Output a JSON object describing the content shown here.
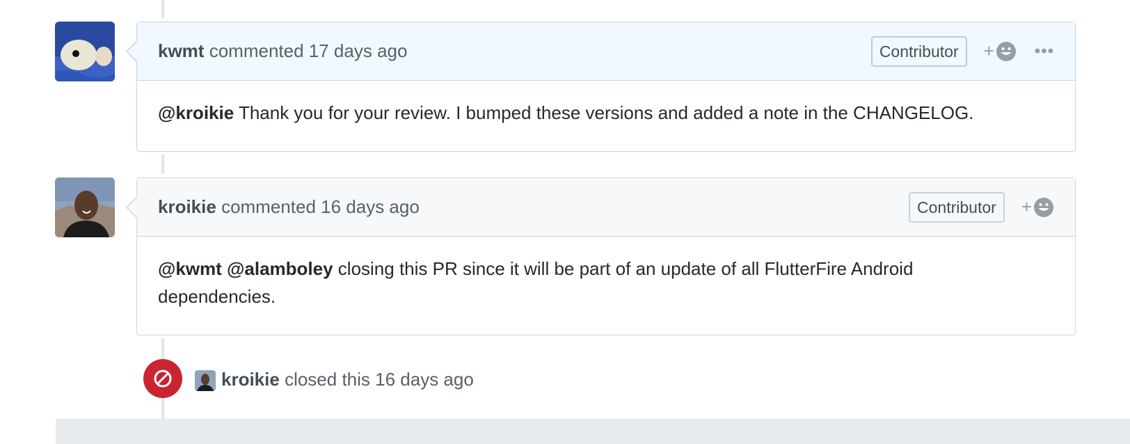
{
  "comments": [
    {
      "author": "kwmt",
      "action": "commented",
      "time": "17 days ago",
      "badge": "Contributor",
      "reaction_plus": "+",
      "more": "•••",
      "mentions": "@kroikie",
      "body": " Thank you for your review. I bumped these versions and added a note in the CHANGELOG."
    },
    {
      "author": "kroikie",
      "action": "commented",
      "time": "16 days ago",
      "badge": "Contributor",
      "reaction_plus": "+",
      "mentions": "@kwmt @alamboley",
      "body": " closing this PR since it will be part of an update of all FlutterFire Android dependencies."
    }
  ],
  "event": {
    "actor": "kroikie",
    "action": "closed this",
    "time": "16 days ago",
    "icon": "circle-slash-icon",
    "color": "#cb2431"
  },
  "colors": {
    "highlight_header": "#f1f8ff",
    "plain_header": "#f6f8fa",
    "border": "#d1d5da"
  }
}
